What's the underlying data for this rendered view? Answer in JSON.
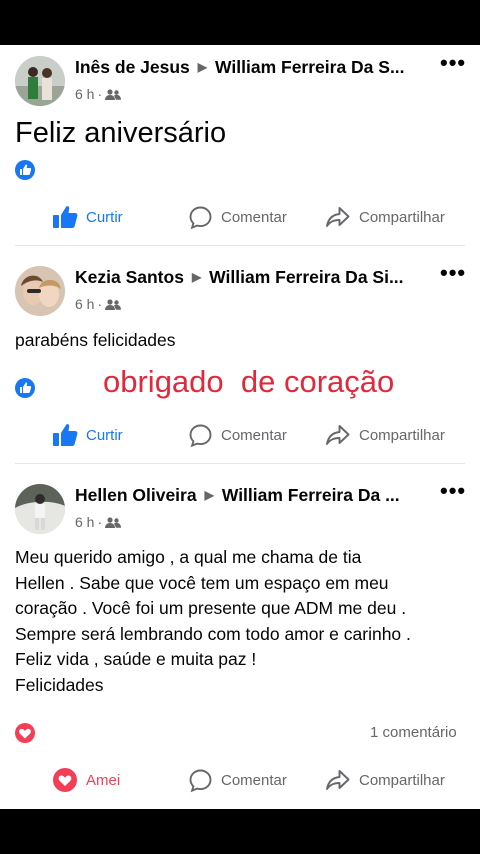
{
  "posts": [
    {
      "author": "Inês de Jesus",
      "target": "William Ferreira Da S...",
      "time": "6 h",
      "body": "Feliz aniversário",
      "reaction": "like",
      "actions": {
        "like": "Curtir",
        "comment": "Comentar",
        "share": "Compartilhar"
      }
    },
    {
      "author": "Kezia Santos",
      "target": "William Ferreira Da Si...",
      "time": "6 h",
      "body": "parabéns felicidades",
      "reaction": "like",
      "actions": {
        "like": "Curtir",
        "comment": "Comentar",
        "share": "Compartilhar"
      }
    },
    {
      "author": "Hellen Oliveira",
      "target": "William Ferreira Da ...",
      "time": "6 h",
      "body_lines": [
        "Meu querido amigo , a qual me chama de tia",
        "Hellen . Sabe que você tem um espaço em meu",
        "coração . Você foi um presente que ADM me deu .",
        "Sempre será lembrando com todo amor e carinho .",
        "Feliz vida , saúde e muita paz !",
        "Felicidades"
      ],
      "reaction": "love",
      "comment_count": "1 comentário",
      "actions": {
        "like": "Amei",
        "comment": "Comentar",
        "share": "Compartilhar"
      }
    }
  ],
  "overlay_caption": "obrigado  de coração",
  "colors": {
    "like_blue": "#1877f2",
    "love_red": "#f33e58",
    "overlay_red": "#e02a3b",
    "secondary": "#65676b"
  }
}
